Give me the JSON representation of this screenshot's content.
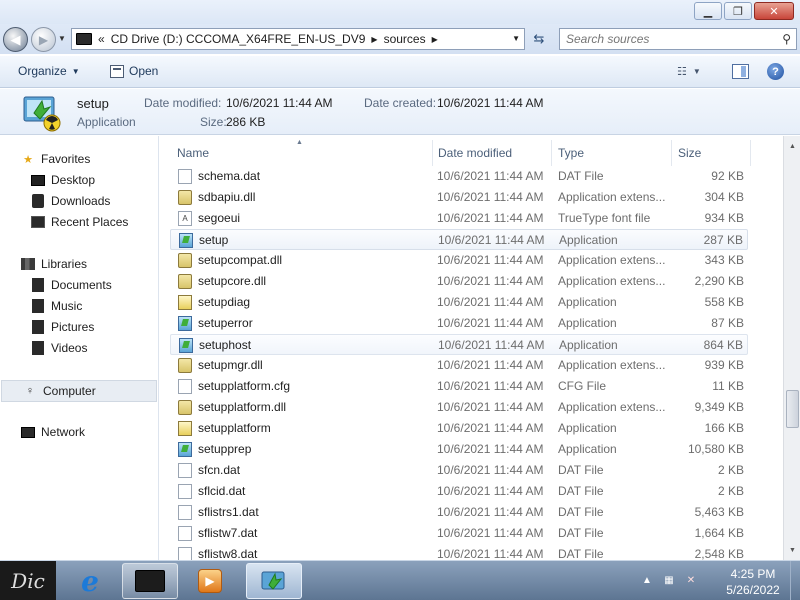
{
  "window": {
    "minimize_glyph": "▁",
    "maximize_glyph": "❐",
    "close_glyph": "✕"
  },
  "address": {
    "overflow": "«",
    "drive": "CD Drive (D:) CCCOMA_X64FRE_EN-US_DV9",
    "folder": "sources",
    "search_placeholder": "Search sources"
  },
  "toolbar": {
    "organize": "Organize",
    "open": "Open"
  },
  "details": {
    "name": "setup",
    "type": "Application",
    "date_modified_label": "Date modified:",
    "date_modified": "10/6/2021 11:44 AM",
    "date_created_label": "Date created:",
    "date_created": "10/6/2021 11:44 AM",
    "size_label": "Size:",
    "size": "286 KB"
  },
  "nav": {
    "favorites": "Favorites",
    "desktop": "Desktop",
    "downloads": "Downloads",
    "recent": "Recent Places",
    "libraries": "Libraries",
    "documents": "Documents",
    "music": "Music",
    "pictures": "Pictures",
    "videos": "Videos",
    "computer": "Computer",
    "network": "Network"
  },
  "columns": {
    "name": "Name",
    "date": "Date modified",
    "type": "Type",
    "size": "Size"
  },
  "files": [
    {
      "name": "schema.dat",
      "date": "10/6/2021 11:44 AM",
      "type": "DAT File",
      "size": "92 KB",
      "icon": "doc"
    },
    {
      "name": "sdbapiu.dll",
      "date": "10/6/2021 11:44 AM",
      "type": "Application extens...",
      "size": "304 KB",
      "icon": "dll"
    },
    {
      "name": "segoeui",
      "date": "10/6/2021 11:44 AM",
      "type": "TrueType font file",
      "size": "934 KB",
      "icon": "font"
    },
    {
      "name": "setup",
      "date": "10/6/2021 11:44 AM",
      "type": "Application",
      "size": "287 KB",
      "icon": "app",
      "state": "sel"
    },
    {
      "name": "setupcompat.dll",
      "date": "10/6/2021 11:44 AM",
      "type": "Application extens...",
      "size": "343 KB",
      "icon": "dll"
    },
    {
      "name": "setupcore.dll",
      "date": "10/6/2021 11:44 AM",
      "type": "Application extens...",
      "size": "2,290 KB",
      "icon": "dll"
    },
    {
      "name": "setupdiag",
      "date": "10/6/2021 11:44 AM",
      "type": "Application",
      "size": "558 KB",
      "icon": "diag"
    },
    {
      "name": "setuperror",
      "date": "10/6/2021 11:44 AM",
      "type": "Application",
      "size": "87 KB",
      "icon": "app"
    },
    {
      "name": "setuphost",
      "date": "10/6/2021 11:44 AM",
      "type": "Application",
      "size": "864 KB",
      "icon": "app",
      "state": "hov"
    },
    {
      "name": "setupmgr.dll",
      "date": "10/6/2021 11:44 AM",
      "type": "Application extens...",
      "size": "939 KB",
      "icon": "dll"
    },
    {
      "name": "setupplatform.cfg",
      "date": "10/6/2021 11:44 AM",
      "type": "CFG File",
      "size": "11 KB",
      "icon": "cfg"
    },
    {
      "name": "setupplatform.dll",
      "date": "10/6/2021 11:44 AM",
      "type": "Application extens...",
      "size": "9,349 KB",
      "icon": "dll"
    },
    {
      "name": "setupplatform",
      "date": "10/6/2021 11:44 AM",
      "type": "Application",
      "size": "166 KB",
      "icon": "diag"
    },
    {
      "name": "setupprep",
      "date": "10/6/2021 11:44 AM",
      "type": "Application",
      "size": "10,580 KB",
      "icon": "app"
    },
    {
      "name": "sfcn.dat",
      "date": "10/6/2021 11:44 AM",
      "type": "DAT File",
      "size": "2 KB",
      "icon": "doc"
    },
    {
      "name": "sflcid.dat",
      "date": "10/6/2021 11:44 AM",
      "type": "DAT File",
      "size": "2 KB",
      "icon": "doc"
    },
    {
      "name": "sflistrs1.dat",
      "date": "10/6/2021 11:44 AM",
      "type": "DAT File",
      "size": "5,463 KB",
      "icon": "doc"
    },
    {
      "name": "sflistw7.dat",
      "date": "10/6/2021 11:44 AM",
      "type": "DAT File",
      "size": "1,664 KB",
      "icon": "doc"
    },
    {
      "name": "sflistw8.dat",
      "date": "10/6/2021 11:44 AM",
      "type": "DAT File",
      "size": "2,548 KB",
      "icon": "doc"
    }
  ],
  "taskbar": {
    "start_label": "Dic",
    "time": "4:25 PM",
    "date": "5/26/2022"
  },
  "colors": {
    "accent": "#1e395b",
    "selection": "#eef3fa",
    "taskbar": "#6f86a3"
  }
}
